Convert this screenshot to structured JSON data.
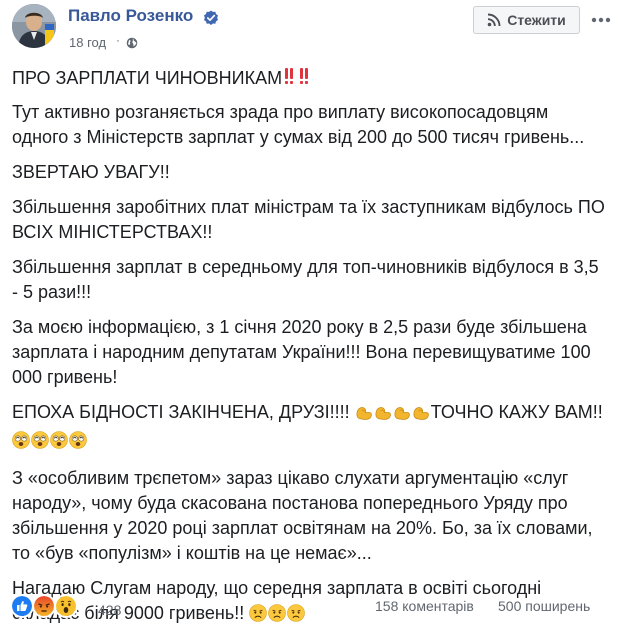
{
  "author": {
    "name": "Павло Розенко",
    "verified": true,
    "time": "18 год",
    "privacy_icon": "globe-icon"
  },
  "follow_button": {
    "label": "Стежити",
    "icon": "rss-icon"
  },
  "more_button": {
    "icon": "ellipsis-icon"
  },
  "post": {
    "title": "ПРО ЗАРПЛАТИ ЧИНОВНИКАМ",
    "paragraphs": [
      "Тут активно розганяється зрада про виплату високопосадовцям одного з Міністерств зарплат у сумах від 200 до 500 тисяч гривень...",
      "ЗВЕРТАЮ УВАГУ!!",
      "Збільшення заробітних плат міністрам та їх заступникам відбулось ПО ВСІХ МІНІСТЕРСТВАХ!!",
      "Збільшення зарплат в середньому для топ-чиновників відбулося в 3,5 - 5 рази!!!",
      "За моєю інформацією, з 1 січня 2020 року в 2,5 рази буде збільшена зарплата і народним депутатам України!!! Вона перевищуватиме 100 000 гривень!"
    ],
    "para_epoch_a": "ЕПОХА БІДНОСТІ ЗАКІНЧЕНА, ДРУЗІ!!!! ",
    "para_epoch_b": "ТОЧНО КАЖУ ВАМ!! ",
    "para_special": "З «особливим трєпетом» зараз цікаво слухати аргументацію «слуг народу», чому буда скасована постанова попереднього Уряду про збільшення у 2020 році зарплат освітянам на 20%. Бо, за їх словами, то «був «популізм» і коштів на це немає»...",
    "para_last": "Нагадаю Слугам народу, що середня зарплата в освіті сьогодні складає біля 9000 гривень!! "
  },
  "footer": {
    "reactions": [
      "like-reaction-icon",
      "angry-reaction-icon",
      "wow-reaction-icon"
    ],
    "reaction_count": "428",
    "comments": "158 коментарів",
    "shares": "500 поширень"
  },
  "colors": {
    "author_link": "#385898",
    "meta_text": "#616770",
    "body_text": "#1c1e21",
    "verified_blue": "#4267b2",
    "exclamation_red": "#e0333d"
  }
}
